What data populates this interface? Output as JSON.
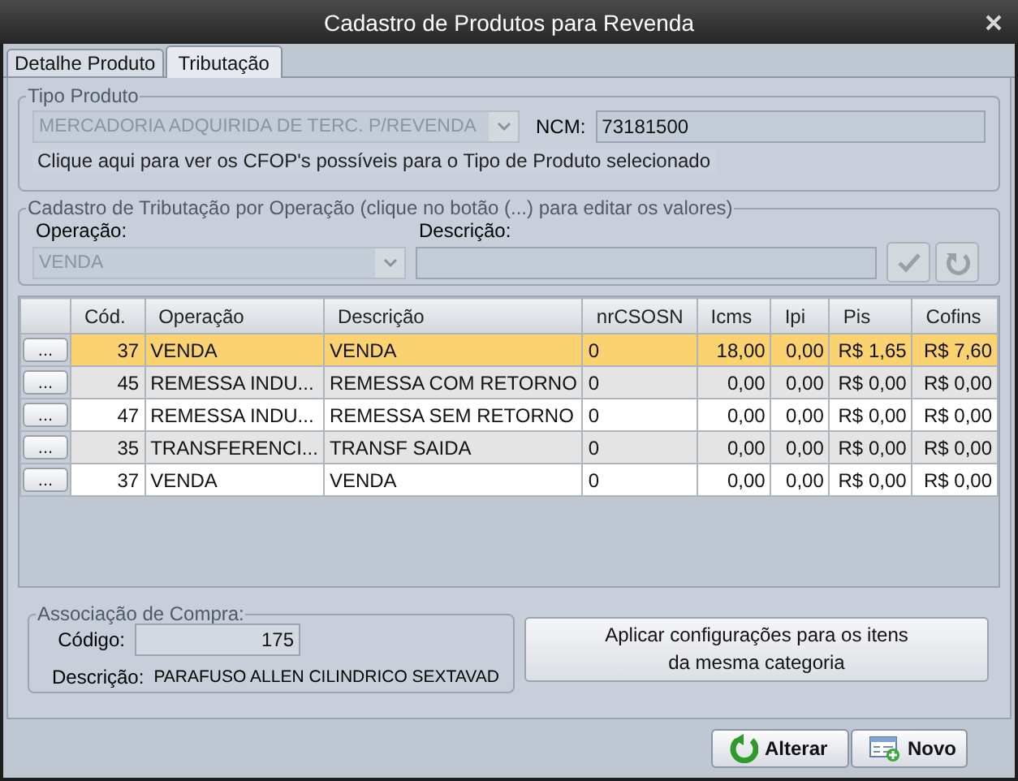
{
  "window": {
    "title": "Cadastro de Produtos para Revenda"
  },
  "tabs": [
    {
      "label": "Detalhe Produto",
      "selected": false
    },
    {
      "label": "Tributação",
      "selected": true
    }
  ],
  "tipo_produto": {
    "title": "Tipo Produto",
    "combo": {
      "value": "MERCADORIA ADQUIRIDA DE TERC. P/REVENDA",
      "disabled": true
    },
    "ncm_label": "NCM:",
    "ncm_value": "73181500",
    "link": "Clique aqui para ver os CFOP's possíveis para o Tipo de Produto selecionado"
  },
  "tributacao": {
    "title": "Cadastro de Tributação por Operação (clique no botão (...) para editar os valores)",
    "operacao_label": "Operação:",
    "operacao": {
      "value": "VENDA",
      "disabled": true
    },
    "descricao_label": "Descrição:",
    "confirm_disabled": true,
    "undo_disabled": true
  },
  "table": {
    "columns": [
      "Cód.",
      "Operação",
      "Descrição",
      "nrCSOSN",
      "Icms",
      "Ipi",
      "Pis",
      "Cofins"
    ],
    "rows": [
      {
        "button": "...",
        "selected": true,
        "cells": [
          "37",
          "VENDA",
          "VENDA",
          "0",
          "18,00",
          "0,00",
          "R$ 1,65",
          "R$ 7,60"
        ]
      },
      {
        "button": "...",
        "selected": false,
        "cells": [
          "45",
          "REMESSA INDU...",
          "REMESSA COM RETORNO",
          "0",
          "0,00",
          "0,00",
          "R$ 0,00",
          "R$ 0,00"
        ]
      },
      {
        "button": "...",
        "selected": false,
        "cells": [
          "47",
          "REMESSA INDU...",
          "REMESSA SEM RETORNO",
          "0",
          "0,00",
          "0,00",
          "R$ 0,00",
          "R$ 0,00"
        ]
      },
      {
        "button": "...",
        "selected": false,
        "cells": [
          "35",
          "TRANSFERENCI...",
          "TRANSF SAIDA",
          "0",
          "0,00",
          "0,00",
          "R$ 0,00",
          "R$ 0,00"
        ]
      },
      {
        "button": "...",
        "selected": false,
        "cells": [
          "37",
          "VENDA",
          "VENDA",
          "0",
          "0,00",
          "0,00",
          "R$ 0,00",
          "R$ 0,00"
        ]
      }
    ]
  },
  "associacao": {
    "title": "Associação de Compra:",
    "codigo_label": "Código:",
    "codigo": "175",
    "descricao_label": "Descrição:",
    "descricao": "PARAFUSO ALLEN CILINDRICO SEXTAVAD"
  },
  "apply_button": [
    "Aplicar configurações para os itens",
    "da mesma categoria"
  ],
  "footer_buttons": [
    {
      "kind": "edit",
      "label": "Alterar"
    },
    {
      "kind": "new",
      "label": "Novo"
    }
  ]
}
